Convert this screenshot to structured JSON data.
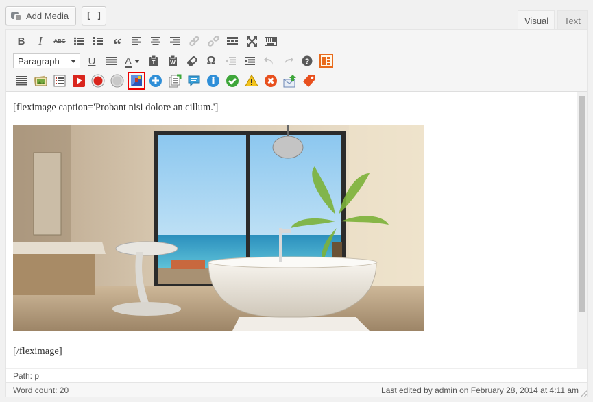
{
  "top": {
    "add_media_label": "Add Media",
    "shortcode_button_label": "[ ]"
  },
  "tabs": {
    "visual": "Visual",
    "text": "Text"
  },
  "toolbar": {
    "format_select_value": "Paragraph",
    "row1": [
      "bold-icon",
      "italic-icon",
      "strikethrough-icon",
      "bullet-list-icon",
      "numbered-list-icon",
      "blockquote-icon",
      "align-left-icon",
      "align-center-icon",
      "align-right-icon",
      "link-icon",
      "unlink-icon",
      "read-more-icon",
      "fullscreen-icon",
      "kitchen-sink-icon"
    ],
    "row2_glyphs": {
      "underline": "U",
      "text_color": "A",
      "special_char": "Ω",
      "help": "?"
    },
    "row3": [
      "grid-icon",
      "image-gallery-icon",
      "list-icon",
      "youtube-icon",
      "record-icon",
      "gray-circle-icon",
      "fleximage-icon",
      "plus-circle-icon",
      "insert-document-icon",
      "comment-icon",
      "info-icon",
      "check-icon",
      "warning-icon",
      "error-icon",
      "mail-upload-icon",
      "tag-icon"
    ],
    "highlighted": "fleximage-icon"
  },
  "content": {
    "line1": "[fleximage caption='Probant nisi dolore an cillum.']",
    "line2": "[/fleximage]"
  },
  "status": {
    "path": "Path: p",
    "word_count": "Word count: 20",
    "last_edited": "Last edited by admin on February 28, 2014 at 4:11 am"
  },
  "colors": {
    "highlight": "#e00000",
    "youtube_red": "#d9251d",
    "blue": "#2f8fd8",
    "green": "#3ea63a",
    "orange": "#e86a1c"
  }
}
